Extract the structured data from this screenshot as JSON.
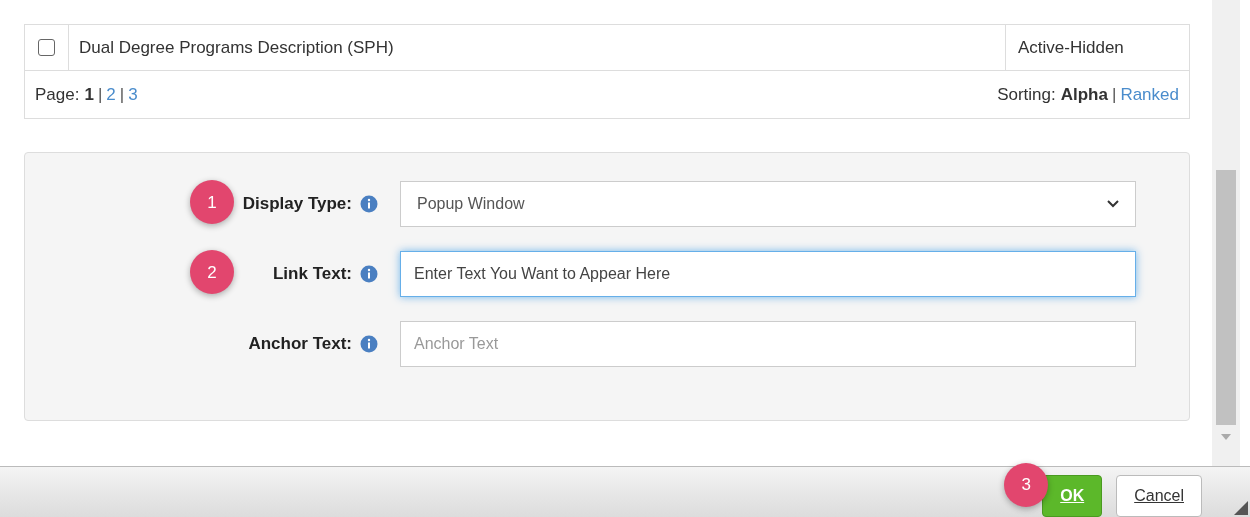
{
  "table": {
    "rows": [
      {
        "checked": false,
        "name": "Dual Degree Programs Description (SPH)",
        "status": "Active-Hidden"
      }
    ]
  },
  "pager": {
    "separator": "|",
    "label": "Page:",
    "pages": [
      {
        "label": "1",
        "selected": true
      },
      {
        "label": "2",
        "selected": false
      },
      {
        "label": "3",
        "selected": false
      }
    ],
    "sorting_label": "Sorting:",
    "sorting": [
      {
        "label": "Alpha",
        "selected": true
      },
      {
        "label": "Ranked",
        "selected": false
      }
    ]
  },
  "form": {
    "fields": [
      {
        "kind": "select",
        "label": "Display Type:",
        "value": "Popup Window",
        "step": "1"
      },
      {
        "kind": "input",
        "label": "Link Text:",
        "value": "Enter Text You Want to Appear Here",
        "focused": true,
        "step": "2"
      },
      {
        "kind": "input",
        "label": "Anchor Text:",
        "placeholder": "Anchor Text",
        "focused": false
      }
    ]
  },
  "footer": {
    "buttons": [
      {
        "kind": "primary",
        "label": "OK",
        "step": "3"
      },
      {
        "kind": "default",
        "label": "Cancel"
      }
    ]
  }
}
